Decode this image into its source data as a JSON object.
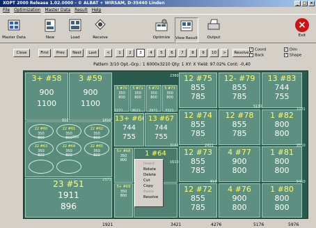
{
  "window": {
    "title": "XOPT 2000 Release 1.02.0000 - © ALBAT + WIRSAM, D-35440 Linden"
  },
  "menu": [
    "File",
    "Optimization",
    "Master Data",
    "Result",
    "Help"
  ],
  "toolbar": {
    "master_data": "Master Data",
    "new": "New",
    "load": "Load",
    "receive": "Receive",
    "optimize": "Optimize",
    "view_result": "View Result",
    "output": "Output",
    "exit": "Exit"
  },
  "nav": {
    "close": "Close",
    "first": "First",
    "prev": "Prev",
    "next": "Next",
    "last": "Last",
    "prev_arrow": "<",
    "pages": [
      "1",
      "2",
      "3",
      "4",
      "5",
      "6",
      "7",
      "8",
      "9",
      "10"
    ],
    "next_arrow": ">",
    "active_page": "3",
    "resolve": "Resolve",
    "checks": {
      "coord": "Coord",
      "back": "Back",
      "dim": "Dim",
      "shape": "Shape"
    }
  },
  "pattern_info": "Pattern 3/10   Opt.-Grp.: 1   6000x3210   Qty: 1   XY: X   Yield: 97.02%   Cont: -0,40",
  "panels": [
    {
      "id": "3+ #58",
      "w": "900",
      "h": "1100"
    },
    {
      "id": "3 #59",
      "w": "900",
      "h": "1100"
    },
    {
      "id": "13+ #66",
      "w": "744",
      "h": "755"
    },
    {
      "id": "13 #67",
      "w": "744",
      "h": "755"
    },
    {
      "id": "23 #51",
      "w": "1911",
      "h": "896"
    },
    {
      "id": "1 #64",
      "w": "",
      "h": ""
    },
    {
      "id": "12 #75",
      "w": "855",
      "h": "785"
    },
    {
      "id": "12 #74",
      "w": "855",
      "h": "785"
    },
    {
      "id": "12 #73",
      "w": "855",
      "h": "785"
    },
    {
      "id": "12 #72",
      "w": "855",
      "h": "785"
    },
    {
      "id": "12- #79",
      "w": "855",
      "h": "785"
    },
    {
      "id": "12 #78",
      "w": "855",
      "h": "785"
    },
    {
      "id": "4 #77",
      "w": "900",
      "h": "800"
    },
    {
      "id": "4 #76",
      "w": "900",
      "h": "800"
    },
    {
      "id": "13 #83",
      "w": "744",
      "h": "755"
    },
    {
      "id": "1 #82",
      "w": "800",
      "h": "800"
    },
    {
      "id": "1 #81",
      "w": "800",
      "h": "800"
    },
    {
      "id": "1 #80",
      "w": "800",
      "h": "800"
    }
  ],
  "small_panels": [
    {
      "id": "5 #70",
      "w": "350",
      "h": "800"
    },
    {
      "id": "5 #71",
      "w": "350",
      "h": "800"
    },
    {
      "id": "5 #72",
      "w": "350",
      "h": "800"
    },
    {
      "id": "5 #73",
      "w": "350",
      "h": "800"
    },
    {
      "id": "22 #60",
      "w": "350",
      "h": "800"
    },
    {
      "id": "22 #61",
      "w": "350",
      "h": "800"
    },
    {
      "id": "22 #62",
      "w": "350",
      "h": "800"
    },
    {
      "id": "22 #63",
      "w": "350",
      "h": "800"
    },
    {
      "id": "22 #64",
      "w": "350",
      "h": "800"
    },
    {
      "id": "22 #65",
      "w": "350",
      "h": "800"
    },
    {
      "id": "5+ #68",
      "w": "350",
      "h": "800"
    },
    {
      "id": "5+ #69",
      "w": "350",
      "h": "800"
    }
  ],
  "marks": [
    "2271",
    "3621",
    "2971",
    "3321",
    "910",
    "1810",
    "2360",
    "3161",
    "2411",
    "1081",
    "1610",
    "2010",
    "900",
    "2371",
    "5131",
    "5410",
    "810"
  ],
  "context_menu": [
    "Insert",
    "Rotate",
    "Delete",
    "Cut",
    "Copy",
    "Paste",
    "Resolve"
  ],
  "x_axis": [
    "1921",
    "3421",
    "4276",
    "5176",
    "5976"
  ]
}
